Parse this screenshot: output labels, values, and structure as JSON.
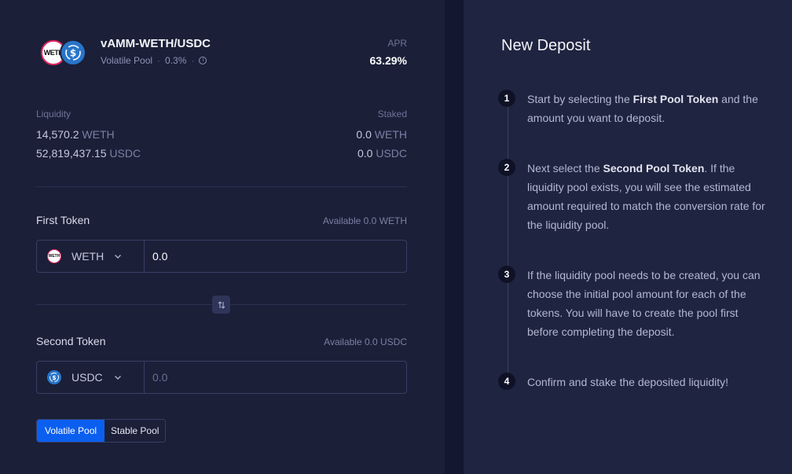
{
  "pair": {
    "name": "vAMM-WETH/USDC",
    "type": "Volatile Pool",
    "fee": "0.3%",
    "token_a_icon_text": "WETH",
    "apr_label": "APR",
    "apr_value": "63.29%"
  },
  "stats": {
    "liquidity_label": "Liquidity",
    "staked_label": "Staked",
    "liquidity_a_value": "14,570.2",
    "liquidity_a_unit": "WETH",
    "liquidity_b_value": "52,819,437.15",
    "liquidity_b_unit": "USDC",
    "staked_a_value": "0.0",
    "staked_a_unit": "WETH",
    "staked_b_value": "0.0",
    "staked_b_unit": "USDC"
  },
  "first_token": {
    "title": "First Token",
    "available": "Available 0.0 WETH",
    "symbol": "WETH",
    "icon_text": "WETH",
    "amount_placeholder": "0.0"
  },
  "second_token": {
    "title": "Second Token",
    "available": "Available 0.0 USDC",
    "symbol": "USDC",
    "amount_placeholder": "0.0"
  },
  "pool_toggle": {
    "volatile": "Volatile Pool",
    "stable": "Stable Pool",
    "selected": "volatile"
  },
  "deposit": {
    "title": "New Deposit",
    "steps": [
      {
        "num": "1",
        "pre": "Start by selecting the ",
        "bold": "First Pool Token",
        "post": " and the amount you want to deposit."
      },
      {
        "num": "2",
        "pre": "Next select the ",
        "bold": "Second Pool Token",
        "post": ". If the liquidity pool exists, you will see the estimated amount required to match the conversion rate for the liquidity pool."
      },
      {
        "num": "3",
        "pre": "If the liquidity pool needs to be created, you can choose the initial pool amount for each of the tokens. You will have to create the pool first before completing the deposit.",
        "bold": "",
        "post": ""
      },
      {
        "num": "4",
        "pre": "Confirm and stake the deposited liquidity!",
        "bold": "",
        "post": ""
      }
    ]
  },
  "colors": {
    "background": "#1b1f38",
    "panel_right": "#1f2440",
    "accent": "#0b5ff0",
    "weth_ring": "#e2255f",
    "usdc_blue": "#2775ca"
  }
}
